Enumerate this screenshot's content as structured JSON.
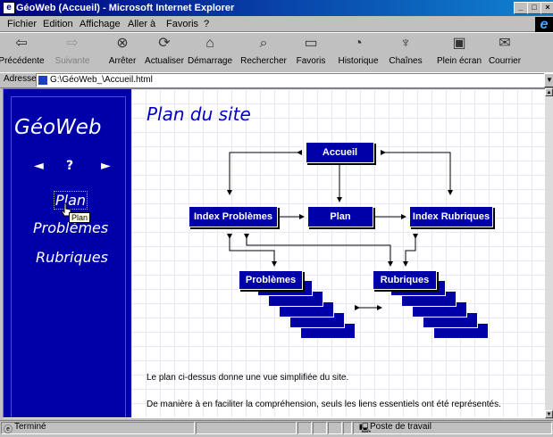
{
  "window": {
    "title": "GéoWeb (Accueil) - Microsoft Internet Explorer",
    "controls": [
      "minimize-icon",
      "maximize-icon",
      "close-icon"
    ]
  },
  "menu": [
    "Fichier",
    "Edition",
    "Affichage",
    "Aller à",
    "Favoris",
    "?"
  ],
  "toolbar": [
    {
      "label": "Précédente",
      "icon": "back-arrow-icon",
      "enabled": true
    },
    {
      "label": "Suivante",
      "icon": "forward-arrow-icon",
      "enabled": false
    },
    {
      "label": "Arrêter",
      "icon": "stop-icon",
      "enabled": true
    },
    {
      "label": "Actualiser",
      "icon": "refresh-icon",
      "enabled": true
    },
    {
      "label": "Démarrage",
      "icon": "home-icon",
      "enabled": true
    },
    {
      "label": "Rechercher",
      "icon": "search-icon",
      "enabled": true
    },
    {
      "label": "Favoris",
      "icon": "favorites-icon",
      "enabled": true
    },
    {
      "label": "Historique",
      "icon": "history-icon",
      "enabled": true
    },
    {
      "label": "Chaînes",
      "icon": "channels-icon",
      "enabled": true
    },
    {
      "label": "Plein écran",
      "icon": "fullscreen-icon",
      "enabled": true
    },
    {
      "label": "Courrier",
      "icon": "mail-icon",
      "enabled": true
    }
  ],
  "address": {
    "label": "Adresse",
    "value": "G:\\GéoWeb_\\Accueil.html"
  },
  "sidebar": {
    "logo": "GéoWeb",
    "nav": {
      "prev": "◄",
      "help": "?",
      "next": "►"
    },
    "links": [
      "Plan",
      "Problèmes",
      "Rubriques"
    ],
    "tooltip": "Plan"
  },
  "main": {
    "title": "Plan du site",
    "diagram": {
      "accueil": "Accueil",
      "index_problemes": "Index Problèmes",
      "plan": "Plan",
      "index_rubriques": "Index Rubriques",
      "problemes": "Problèmes",
      "rubriques": "Rubriques"
    },
    "paragraphs": [
      "Le plan ci-dessus donne une vue simplifiée du site.",
      "De manière à en faciliter la compréhension, seuls les liens essentiels ont été représentés."
    ]
  },
  "status": {
    "text": "Terminé",
    "zone": "Poste de travail"
  },
  "colors": {
    "sidebar": "#0000a8",
    "title": "#0000c8",
    "titlebar": "#000080"
  }
}
